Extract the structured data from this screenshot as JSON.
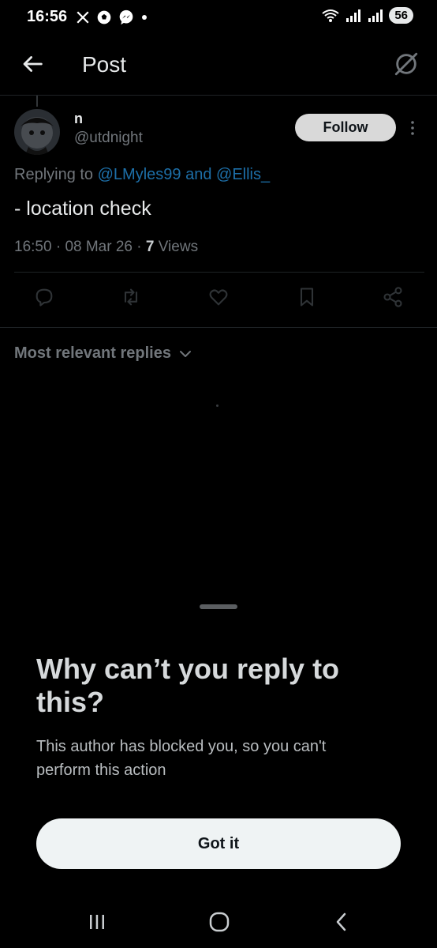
{
  "status_bar": {
    "time": "16:56",
    "battery": "56",
    "notification_icons": [
      "x-logo-icon",
      "soccer-ball-icon",
      "messenger-icon",
      "dot-icon"
    ],
    "system_icons": [
      "wifi-icon",
      "signal-icon",
      "signal-icon"
    ]
  },
  "header": {
    "title": "Post"
  },
  "post": {
    "display_name": "n",
    "handle": "@utdnight",
    "follow_label": "Follow",
    "replying_prefix": "Replying to ",
    "replying_mention_1": "@LMyles99",
    "replying_and": " and ",
    "replying_mention_2": "@Ellis_",
    "text": "- location check",
    "time": "16:50",
    "sep1": " · ",
    "date": "08 Mar 26",
    "sep2": " · ",
    "views_count": "7",
    "views_label": " Views"
  },
  "replies": {
    "sort_label": "Most relevant replies"
  },
  "sheet": {
    "title": "Why can’t you reply to this?",
    "body": "This author has blocked you, so you can't perform this action",
    "button_label": "Got it"
  },
  "colors": {
    "background": "#000000",
    "mention": "#1d6fa8",
    "muted_text": "#71767b",
    "button_light": "#eff3f4"
  }
}
